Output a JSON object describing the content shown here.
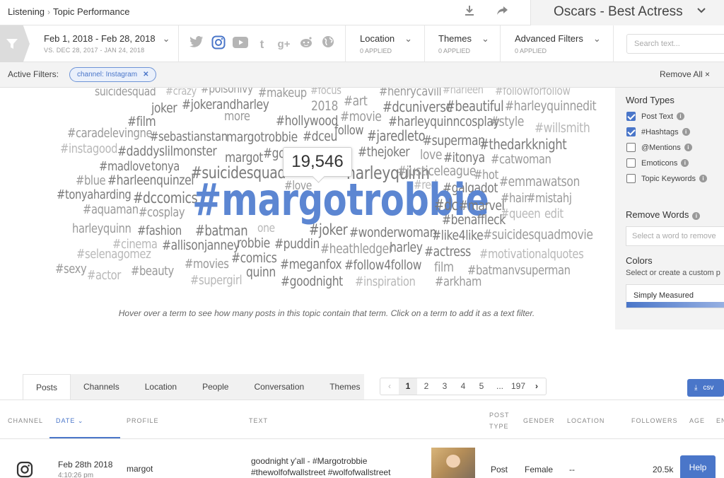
{
  "breadcrumb": {
    "root": "Listening",
    "current": "Topic Performance"
  },
  "topic": {
    "title": "Oscars - Best Actress"
  },
  "filters": {
    "date_main": "Feb 1, 2018 - Feb 28, 2018",
    "date_vs": "VS. DEC 28, 2017 - JAN 24, 2018",
    "channels": [
      "twitter",
      "instagram",
      "youtube",
      "tumblr",
      "google-plus",
      "reddit",
      "web"
    ],
    "active_channel": "instagram",
    "location": {
      "label": "Location",
      "sub": "0 APPLIED"
    },
    "themes": {
      "label": "Themes",
      "sub": "0 APPLIED"
    },
    "advanced": {
      "label": "Advanced Filters",
      "sub": "0 APPLIED"
    },
    "search_placeholder": "Search text..."
  },
  "active_filters": {
    "label": "Active Filters:",
    "chip": "channel: Instagram",
    "remove_all": "Remove All ×"
  },
  "cloud": {
    "tooltip": "19,546",
    "hint": "Hover over a term to see how many posts in this topic contain that term. Click on a term to add it as a text filter.",
    "terms": [
      "suicidesquad",
      "#crazy",
      "#poisonivy",
      "#makeup",
      "#focus",
      "#henrycavill",
      "#harleen",
      "#followforfollow",
      "joker",
      "#jokerandharley",
      "2018",
      "#art",
      "#dcuniverse",
      "#beautiful",
      "#harleyquinnedit",
      "#film",
      "more",
      "#hollywood",
      "#movie",
      "#harleyquinncosplay",
      "#style",
      "#caradelevingne",
      "#sebastianstan",
      "margotrobbie",
      "#dceu",
      "follow",
      "#jaredleto",
      "#willsmith",
      "#instagood",
      "#daddyslilmonster",
      "margot",
      "#got",
      "#superman",
      "#thedarkknight",
      "#madlove",
      "tonya",
      "#thejoker",
      "love",
      "#itonya",
      "#catwoman",
      "#suicidesquad",
      "harleyquinn",
      "#justiceleague",
      "#hot",
      "#blue",
      "#harleenquinzel",
      "#love",
      "#red",
      "#galgadot",
      "#emmawatson",
      "#tonyaharding",
      "#dccomics",
      "#margotrobbie",
      "#dc",
      "#hair",
      "#mistahj",
      "#aquaman",
      "#cosplay",
      "#marvel",
      "#queen",
      "edit",
      "#benaffleck",
      "harleyquinn",
      "#fashion",
      "#batman",
      "one",
      "#joker",
      "#wonderwoman",
      "#like4like",
      "#suicidesquadmovie",
      "#cinema",
      "#allisonjanney",
      "robbie",
      "#puddin",
      "harley",
      "#selenagomez",
      "#heathledger",
      "#actress",
      "#motivationalquotes",
      "#comics",
      "#sexy",
      "#beauty",
      "#movies",
      "quinn",
      "#meganfox",
      "#follow4follow",
      "film",
      "#actor",
      "#batmanvsuperman",
      "#supergirl",
      "#goodnight",
      "#inspiration",
      "#arkham"
    ]
  },
  "sidebar": {
    "word_types_title": "Word Types",
    "word_types": [
      {
        "label": "Post Text",
        "checked": true
      },
      {
        "label": "#Hashtags",
        "checked": true
      },
      {
        "label": "@Mentions",
        "checked": false
      },
      {
        "label": "Emoticons",
        "checked": false
      },
      {
        "label": "Topic Keywords",
        "checked": false
      }
    ],
    "remove_words_title": "Remove Words",
    "remove_words_placeholder": "Select a word to remove",
    "colors_title": "Colors",
    "colors_sub": "Select or create a custom p",
    "palette_name": "Simply Measured",
    "accent": "#4a76c9"
  },
  "tabs": [
    "Posts",
    "Channels",
    "Location",
    "People",
    "Conversation",
    "Themes"
  ],
  "active_tab": "Posts",
  "pager": {
    "pages": [
      "1",
      "2",
      "3",
      "4",
      "5",
      "...",
      "197"
    ],
    "current": "1"
  },
  "export_label": "csv",
  "table": {
    "headers": {
      "channel": "CHANNEL",
      "date": "DATE",
      "profile": "PROFILE",
      "text": "TEXT",
      "post_type_1": "POST",
      "post_type_2": "TYPE",
      "gender": "GENDER",
      "location": "LOCATION",
      "followers": "FOLLOWERS",
      "age": "AGE",
      "extra": "EN"
    },
    "rows": [
      {
        "channel_icon": "instagram-icon",
        "date": "Feb 28th 2018",
        "time": "4:10:26 pm",
        "profile": "margot",
        "text_line1": "goodnight y'all - #Margotrobbie",
        "text_line2": "#thewolfofwallstreet #wolfofwallstreet",
        "post_type": "Post",
        "gender": "Female",
        "location": "--",
        "followers": "20.5k"
      }
    ]
  },
  "help_label": "Help"
}
